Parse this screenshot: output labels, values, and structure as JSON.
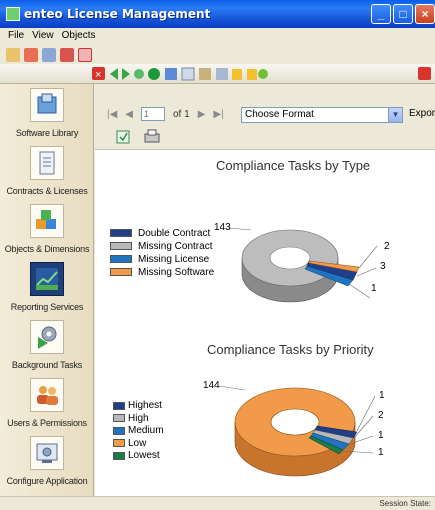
{
  "window": {
    "title": "enteo License Management"
  },
  "menu": [
    "File",
    "View",
    "Objects"
  ],
  "sidebar": {
    "items": [
      {
        "label": "Software Library"
      },
      {
        "label": "Contracts & Licenses"
      },
      {
        "label": "Objects & Dimensions"
      },
      {
        "label": "Reporting Services"
      },
      {
        "label": "Background Tasks"
      },
      {
        "label": "Users & Permissions"
      },
      {
        "label": "Configure Application"
      }
    ],
    "active_index": 3
  },
  "report_toolbar": {
    "page_value": "1",
    "of_label": "of 1",
    "format_placeholder": "Choose Format",
    "export_label": "Export"
  },
  "charts": [
    {
      "title": "Compliance Tasks by Type",
      "legend": [
        "Double Contract",
        "Missing Contract",
        "Missing License",
        "Missing Software"
      ],
      "labels": [
        "143",
        "2",
        "3",
        "1"
      ]
    },
    {
      "title": "Compliance Tasks by Priority",
      "legend": [
        "Highest",
        "High",
        "Medium",
        "Low",
        "Lowest"
      ],
      "labels": [
        "144",
        "1",
        "2",
        "1",
        "1"
      ]
    }
  ],
  "chart_data": [
    {
      "type": "pie",
      "title": "Compliance Tasks by Type",
      "categories": [
        "Double Contract",
        "Missing Contract",
        "Missing License",
        "Missing Software"
      ],
      "values": [
        2,
        143,
        3,
        1
      ],
      "colors": [
        "#1f3f8a",
        "#b8b8b8",
        "#1f73c0",
        "#f09a4a"
      ],
      "style": "3d-doughnut",
      "legend": "left"
    },
    {
      "type": "pie",
      "title": "Compliance Tasks by Priority",
      "categories": [
        "Highest",
        "High",
        "Medium",
        "Low",
        "Lowest"
      ],
      "values": [
        1,
        1,
        2,
        144,
        1
      ],
      "colors": [
        "#1f3f8a",
        "#b8b8b8",
        "#1f73c0",
        "#f09a4a",
        "#1f7a4a"
      ],
      "style": "3d-doughnut",
      "legend": "left"
    }
  ],
  "status": {
    "session_label": "Session State:"
  }
}
